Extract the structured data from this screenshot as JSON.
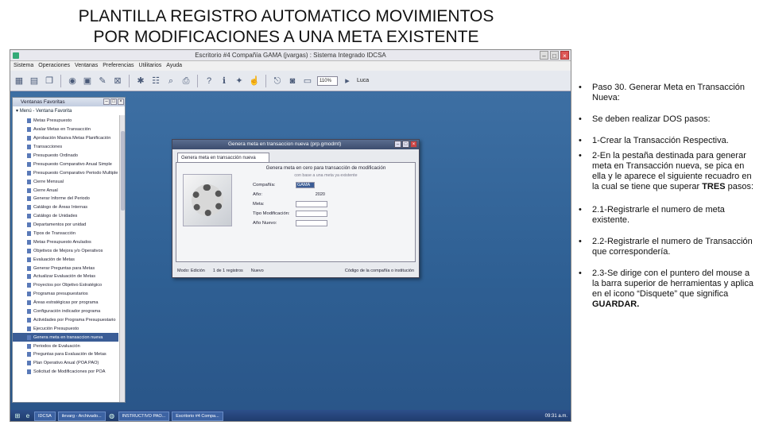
{
  "slide": {
    "title_line1": "PLANTILLA REGISTRO AUTOMATICO MOVIMIENTOS",
    "title_line2": "POR MODIFICACIONES A UNA META EXISTENTE"
  },
  "app": {
    "window_title": "Escritorio #4 Compañía GAMA (jvargas) : Sistema Integrado IDCSA",
    "menu": [
      "Sistema",
      "Operaciones",
      "Ventanas",
      "Preferencias",
      "Utilitarios",
      "Ayuda"
    ],
    "zoom": "110%",
    "user": "Luca"
  },
  "favorites": {
    "title": "Ventanas Favoritas",
    "root": "Menú - Ventana Favorita",
    "items": [
      "Metas Presupuesto",
      "Avalar Metas en Transacción",
      "Aprobación Masiva Metas Planificación",
      "Transacciones",
      "Presupuesto Ordinado",
      "Presupuesto Comparativo Anual Simple",
      "Presupuesto Comparativo Periodo Multiple",
      "Cierre Mensual",
      "Cierre Anual",
      "Generar Informe del Periodo",
      "Catálogo de Áreas Internas",
      "Catálogo de Unidades",
      "Departamentos por unidad",
      "Tipos de Transacción",
      "Metas Presupuesto Anulados",
      "Objetivos de Mejora y/o Operativos",
      "Evaluación de Metas",
      "Generar Preguntas para Metas",
      "Actualizar Evaluación de Metas",
      "Proyectos por Objetivo Estratégico",
      "Programas presupuestarios",
      "Áreas estratégicas por programa",
      "Configuración indicador programa",
      "Actividades por Programa Presupuestario",
      "Ejecución Presupuesto",
      "Genera meta en transaccion nueva",
      "Periodos de Evaluación",
      "Preguntas para Evaluación de Metas",
      "Plan Operativo Anual (POA PAO)",
      "Solicitud de Modificaciones por POA"
    ],
    "selected_index": 25
  },
  "dialog": {
    "title": "Genera meta en transaccion nueva (prp.gmodmt)",
    "tab": "Genera meta en transacción nueva",
    "heading": "Genera meta en cero para transacción de modificación",
    "subheading": "con base a una meta ya existente",
    "fields": [
      {
        "label": "Compañía:",
        "value": "GAMA"
      },
      {
        "label": "Año:",
        "value": "2020"
      },
      {
        "label": "Meta:",
        "value": ""
      },
      {
        "label": "Tipo Modificación:",
        "value": ""
      },
      {
        "label": "Año Nuevo:",
        "value": ""
      }
    ],
    "status_mode": "Modo: Edición",
    "status_records": "1 de 1 registros",
    "status_state": "Nuevo",
    "status_hint": "Código de la compañía o institución"
  },
  "taskbar": {
    "buttons": [
      "IDCSA",
      "ilevarg - Archivado...",
      "INSTRUCTIVO PAO...",
      "Escritorio #4 Compa..."
    ],
    "clock": "09:31 a.m."
  },
  "bullets": [
    {
      "text": "Paso 30.  Generar Meta en Transacción Nueva:",
      "bold": ""
    },
    {
      "text": "Se deben realizar DOS pasos:",
      "bold": ""
    },
    {
      "text": "1-Crear la Transacción Respectiva.",
      "bold": ""
    },
    {
      "text": "2-En la pestaña destinada para generar meta en Transacción nueva, se pica en ella y le aparece el siguiente recuadro en la cual se tiene que superar ",
      "bold": "TRES",
      "after": " pasos:"
    },
    {
      "text": "2.1-Registrarle el numero de meta existente.",
      "bold": ""
    },
    {
      "text": "2.2-Registrarle el numero de Transacción que correspondería.",
      "bold": ""
    },
    {
      "text": "2.3-Se dirige con el puntero del mouse a la barra superior de herramientas y aplica en el icono “Disquete” que significa ",
      "bold": "GUARDAR."
    }
  ],
  "icons": {
    "toolbar": [
      "grid-icon",
      "list-icon",
      "copy-icon",
      "record-icon",
      "save-icon",
      "edit-icon",
      "delete-icon",
      "tools-icon",
      "report-icon",
      "search-icon",
      "help-icon",
      "info-icon",
      "star-icon",
      "print-icon",
      "camera-icon"
    ]
  }
}
